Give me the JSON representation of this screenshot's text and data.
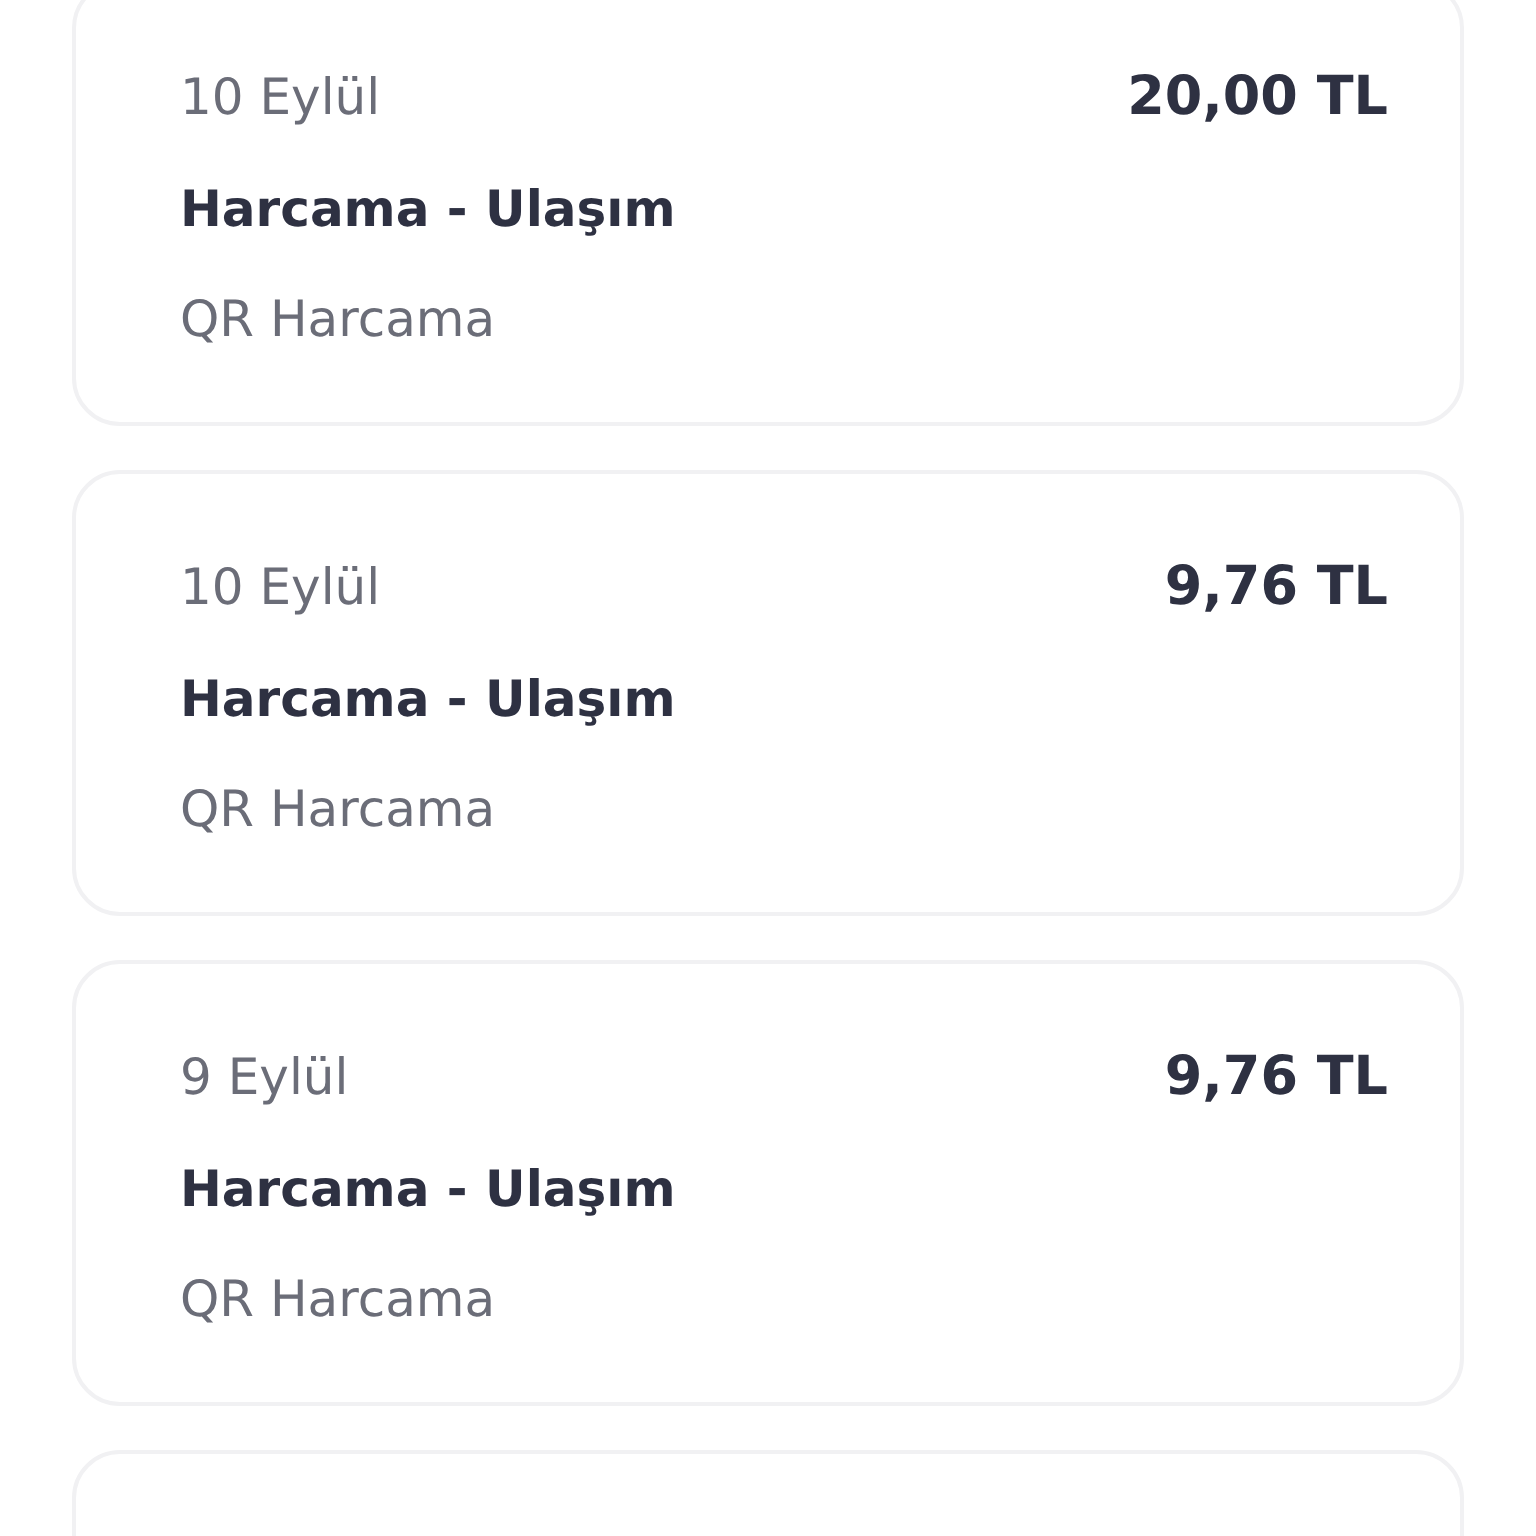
{
  "transactions": [
    {
      "date": "10 Eylül",
      "amount": "20,00 TL",
      "title": "Harcama - Ulaşım",
      "subtitle": "QR Harcama"
    },
    {
      "date": "10 Eylül",
      "amount": "9,76 TL",
      "title": "Harcama - Ulaşım",
      "subtitle": "QR Harcama"
    },
    {
      "date": "9 Eylül",
      "amount": "9,76 TL",
      "title": "Harcama - Ulaşım",
      "subtitle": "QR Harcama"
    }
  ]
}
